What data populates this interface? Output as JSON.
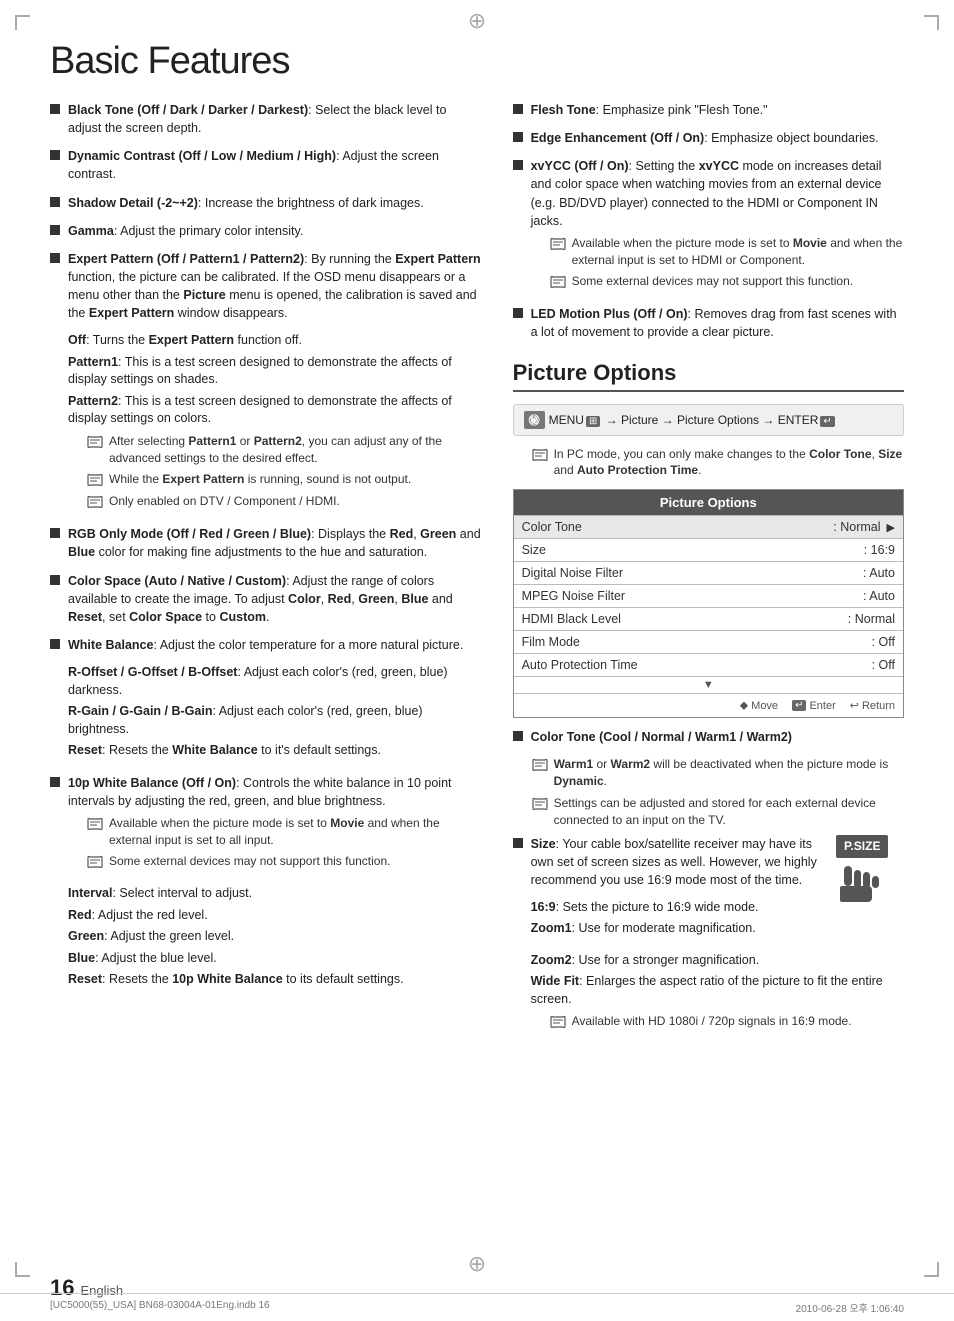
{
  "page": {
    "title": "Basic Features",
    "page_number": "16",
    "page_label": "English",
    "footer_left": "[UC5000(55)_USA] BN68-03004A-01Eng.indb   16",
    "footer_right": "2010-06-28   오후 1:06:40"
  },
  "left_col": {
    "items": [
      {
        "id": "black-tone",
        "label": "Black Tone (Off / Dark / Darker / Darkest)",
        "text": ": Select the black level to adjust the screen depth."
      },
      {
        "id": "dynamic-contrast",
        "label": "Dynamic Contrast (Off / Low / Medium / High)",
        "text": ": Adjust the screen contrast."
      },
      {
        "id": "shadow-detail",
        "label": "Shadow Detail (-2~+2)",
        "text": ": Increase the brightness of dark images."
      },
      {
        "id": "gamma",
        "label": "Gamma",
        "text": ": Adjust the primary color intensity."
      },
      {
        "id": "expert-pattern",
        "label": "Expert Pattern (Off / Pattern1 / Pattern2)",
        "text": ": By running the Expert Pattern function, the picture can be calibrated. If the OSD menu disappears or a menu other than the Picture menu is opened, the calibration is saved and the Expert Pattern window disappears."
      }
    ],
    "expert_sub": [
      {
        "id": "off",
        "label": "Off",
        "text": ": Turns the Expert Pattern function off."
      },
      {
        "id": "pattern1",
        "label": "Pattern1",
        "text": ": This is a test screen designed to demonstrate the affects of display settings on shades."
      },
      {
        "id": "pattern2",
        "label": "Pattern2",
        "text": ": This is a test screen designed to demonstrate the affects of display settings on colors."
      }
    ],
    "expert_notes": [
      "After selecting Pattern1 or Pattern2, you can adjust any of the advanced settings to the desired effect.",
      "While the Expert Pattern is running, sound is not output.",
      "Only enabled on DTV / Component / HDMI."
    ],
    "items2": [
      {
        "id": "rgb-only",
        "label": "RGB Only Mode (Off / Red / Green / Blue)",
        "text": ": Displays the Red, Green and Blue color for making fine adjustments to the hue and saturation."
      },
      {
        "id": "color-space",
        "label": "Color Space (Auto / Native / Custom)",
        "text": ": Adjust the range of colors available to create the image. To adjust Color, Red, Green, Blue and Reset, set Color Space to Custom."
      },
      {
        "id": "white-balance",
        "label": "White Balance",
        "text": ": Adjust the color temperature for a more natural picture."
      }
    ],
    "white_balance_sub": [
      {
        "id": "r-offset",
        "label": "R-Offset / G-Offset / B-Offset",
        "text": ": Adjust each color's (red, green, blue) darkness."
      },
      {
        "id": "r-gain",
        "label": "R-Gain / G-Gain / B-Gain",
        "text": ": Adjust each color's (red, green, blue) brightness."
      },
      {
        "id": "reset-wb",
        "label": "Reset",
        "text": ": Resets the White Balance to it's default settings."
      }
    ],
    "items3": [
      {
        "id": "10p-white-balance",
        "label": "10p White Balance (Off / On)",
        "text": ": Controls the white balance in 10 point intervals by adjusting the red, green, and blue brightness."
      }
    ],
    "ten_p_notes": [
      "Available when the picture mode is set to Movie and when the external input is set to all input.",
      "Some external devices may not support this function."
    ],
    "ten_p_sub": [
      {
        "id": "interval",
        "label": "Interval",
        "text": ": Select interval to adjust."
      },
      {
        "id": "red",
        "label": "Red",
        "text": ": Adjust the red level."
      },
      {
        "id": "green",
        "label": "Green",
        "text": ": Adjust the green level."
      },
      {
        "id": "blue",
        "label": "Blue",
        "text": ": Adjust the blue level."
      },
      {
        "id": "reset-10p",
        "label": "Reset",
        "text": ": Resets the 10p White Balance to its default settings."
      }
    ]
  },
  "right_col": {
    "items": [
      {
        "id": "flesh-tone",
        "label": "Flesh Tone",
        "text": ": Emphasize pink \"Flesh Tone.\""
      },
      {
        "id": "edge-enhancement",
        "label": "Edge Enhancement (Off / On)",
        "text": ": Emphasize object boundaries."
      },
      {
        "id": "xvycc",
        "label": "xvYCC (Off / On)",
        "text": ": Setting the xvYCC mode on increases detail and color space when watching movies from an external device (e.g. BD/DVD player) connected to the HDMI or Component IN jacks."
      }
    ],
    "xvycc_notes": [
      "Available when the picture mode is set to Movie and when the external input is set to HDMI or Component.",
      "Some external devices may not support this function."
    ],
    "items2": [
      {
        "id": "led-motion-plus",
        "label": "LED Motion Plus (Off / On)",
        "text": ": Removes drag from fast scenes with a lot of movement to provide a clear picture."
      }
    ],
    "picture_options": {
      "section_title": "Picture Options",
      "menu_path": "MENU",
      "menu_arrow": "→ Picture → Picture Options → ENTER",
      "note": "In PC mode, you can only make changes to the Color Tone, Size and Auto Protection Time.",
      "table_title": "Picture Options",
      "rows": [
        {
          "label": "Color Tone",
          "value": ": Normal",
          "selected": true,
          "has_arrow": true
        },
        {
          "label": "Size",
          "value": ": 16:9",
          "selected": false,
          "has_arrow": false
        },
        {
          "label": "Digital Noise Filter",
          "value": ": Auto",
          "selected": false,
          "has_arrow": false
        },
        {
          "label": "MPEG Noise Filter",
          "value": ": Auto",
          "selected": false,
          "has_arrow": false
        },
        {
          "label": "HDMI Black Level",
          "value": ": Normal",
          "selected": false,
          "has_arrow": false
        },
        {
          "label": "Film Mode",
          "value": ": Off",
          "selected": false,
          "has_arrow": false
        },
        {
          "label": "Auto Protection Time",
          "value": ": Off",
          "selected": false,
          "has_arrow": false
        }
      ],
      "table_footer": [
        "Move",
        "Enter",
        "Return"
      ]
    },
    "color_tone_note": "Color Tone (Cool / Normal / Warm1 / Warm2)",
    "color_tone_notes": [
      "Warm1 or Warm2 will be deactivated when the picture mode is Dynamic.",
      "Settings can be adjusted and stored for each external device connected to an input on the TV."
    ],
    "size_item": {
      "label": "Size",
      "text": ": Your cable box/satellite receiver may have its own set of screen sizes as well. However, we highly recommend you use 16:9 mode most of the time."
    },
    "size_sub": [
      {
        "label": "16:9",
        "text": ": Sets the picture to 16:9 wide mode."
      },
      {
        "label": "Zoom1",
        "text": ": Use for moderate magnification."
      },
      {
        "label": "Zoom2",
        "text": ": Use for a stronger magnification."
      },
      {
        "label": "Wide Fit",
        "text": ": Enlarges the aspect ratio of the picture to fit the entire screen."
      }
    ],
    "size_notes": [
      "Available with HD 1080i / 720p signals in 16:9 mode."
    ],
    "p_size_label": "P.SIZE"
  }
}
